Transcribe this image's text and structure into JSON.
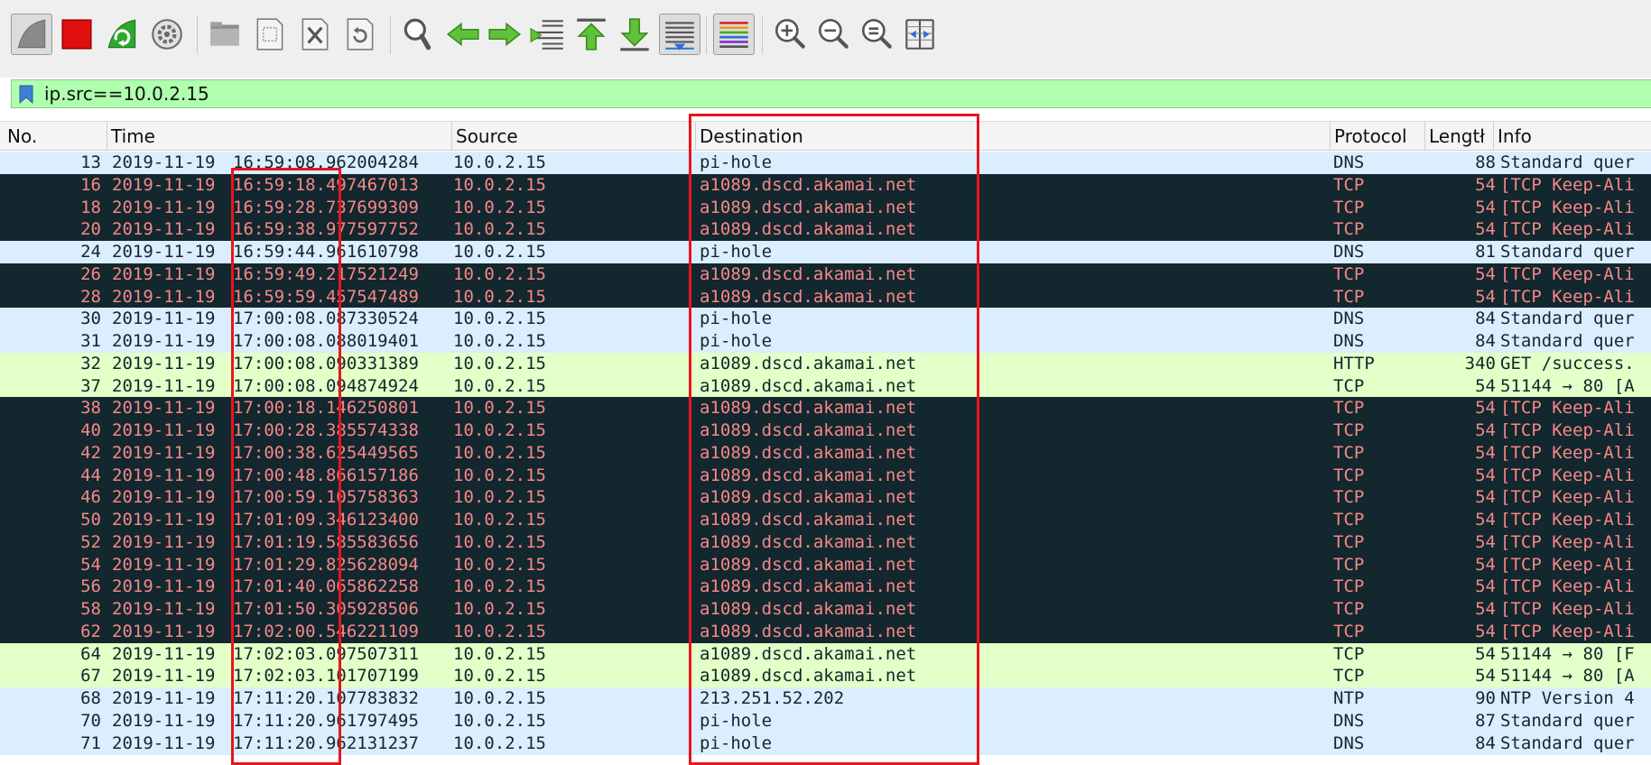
{
  "colors": {
    "toolbar_bg": "#efefef",
    "filter_bg": "#afffaf",
    "dns_row": "#daeeff",
    "tcp_keepalive_row": "#12272e",
    "tcp_keepalive_text": "#f78787",
    "http_row": "#e4ffc7",
    "highlight_box": "#e8141e"
  },
  "toolbar": {
    "items": [
      {
        "name": "start-capture-icon"
      },
      {
        "name": "stop-capture-icon"
      },
      {
        "name": "restart-capture-icon"
      },
      {
        "name": "capture-options-icon"
      },
      {
        "name": "open-file-icon"
      },
      {
        "name": "save-file-icon"
      },
      {
        "name": "close-file-icon"
      },
      {
        "name": "reload-file-icon"
      },
      {
        "name": "find-packet-icon"
      },
      {
        "name": "go-back-icon"
      },
      {
        "name": "go-forward-icon"
      },
      {
        "name": "go-to-packet-icon"
      },
      {
        "name": "go-first-packet-icon"
      },
      {
        "name": "go-last-packet-icon"
      },
      {
        "name": "autoscroll-icon"
      },
      {
        "name": "colorize-icon"
      },
      {
        "name": "zoom-in-icon"
      },
      {
        "name": "zoom-out-icon"
      },
      {
        "name": "normal-size-icon"
      },
      {
        "name": "resize-columns-icon"
      }
    ]
  },
  "filter": {
    "value": "ip.src==10.0.2.15"
  },
  "columns": {
    "no": "No.",
    "time": "Time",
    "source": "Source",
    "destination": "Destination",
    "protocol": "Protocol",
    "length": "Lengtł",
    "info": "Info"
  },
  "packets": [
    {
      "no": "13",
      "date": "2019-11-19",
      "time": "16:59:08.962004284",
      "src": "10.0.2.15",
      "dst": "pi-hole",
      "proto": "DNS",
      "len": "88",
      "info": "Standard quer",
      "kind": "dns"
    },
    {
      "no": "16",
      "date": "2019-11-19",
      "time": "16:59:18.497467013",
      "src": "10.0.2.15",
      "dst": "a1089.dscd.akamai.net",
      "proto": "TCP",
      "len": "54",
      "info": "[TCP Keep-Ali",
      "kind": "tcpka"
    },
    {
      "no": "18",
      "date": "2019-11-19",
      "time": "16:59:28.737699309",
      "src": "10.0.2.15",
      "dst": "a1089.dscd.akamai.net",
      "proto": "TCP",
      "len": "54",
      "info": "[TCP Keep-Ali",
      "kind": "tcpka"
    },
    {
      "no": "20",
      "date": "2019-11-19",
      "time": "16:59:38.977597752",
      "src": "10.0.2.15",
      "dst": "a1089.dscd.akamai.net",
      "proto": "TCP",
      "len": "54",
      "info": "[TCP Keep-Ali",
      "kind": "tcpka"
    },
    {
      "no": "24",
      "date": "2019-11-19",
      "time": "16:59:44.961610798",
      "src": "10.0.2.15",
      "dst": "pi-hole",
      "proto": "DNS",
      "len": "81",
      "info": "Standard quer",
      "kind": "dns"
    },
    {
      "no": "26",
      "date": "2019-11-19",
      "time": "16:59:49.217521249",
      "src": "10.0.2.15",
      "dst": "a1089.dscd.akamai.net",
      "proto": "TCP",
      "len": "54",
      "info": "[TCP Keep-Ali",
      "kind": "tcpka"
    },
    {
      "no": "28",
      "date": "2019-11-19",
      "time": "16:59:59.457547489",
      "src": "10.0.2.15",
      "dst": "a1089.dscd.akamai.net",
      "proto": "TCP",
      "len": "54",
      "info": "[TCP Keep-Ali",
      "kind": "tcpka"
    },
    {
      "no": "30",
      "date": "2019-11-19",
      "time": "17:00:08.087330524",
      "src": "10.0.2.15",
      "dst": "pi-hole",
      "proto": "DNS",
      "len": "84",
      "info": "Standard quer",
      "kind": "dns"
    },
    {
      "no": "31",
      "date": "2019-11-19",
      "time": "17:00:08.088019401",
      "src": "10.0.2.15",
      "dst": "pi-hole",
      "proto": "DNS",
      "len": "84",
      "info": "Standard quer",
      "kind": "dns"
    },
    {
      "no": "32",
      "date": "2019-11-19",
      "time": "17:00:08.090331389",
      "src": "10.0.2.15",
      "dst": "a1089.dscd.akamai.net",
      "proto": "HTTP",
      "len": "340",
      "info": "GET /success.",
      "kind": "http"
    },
    {
      "no": "37",
      "date": "2019-11-19",
      "time": "17:00:08.094874924",
      "src": "10.0.2.15",
      "dst": "a1089.dscd.akamai.net",
      "proto": "TCP",
      "len": "54",
      "info": "51144 → 80 [A",
      "kind": "tcp-light"
    },
    {
      "no": "38",
      "date": "2019-11-19",
      "time": "17:00:18.146250801",
      "src": "10.0.2.15",
      "dst": "a1089.dscd.akamai.net",
      "proto": "TCP",
      "len": "54",
      "info": "[TCP Keep-Ali",
      "kind": "tcpka"
    },
    {
      "no": "40",
      "date": "2019-11-19",
      "time": "17:00:28.385574338",
      "src": "10.0.2.15",
      "dst": "a1089.dscd.akamai.net",
      "proto": "TCP",
      "len": "54",
      "info": "[TCP Keep-Ali",
      "kind": "tcpka"
    },
    {
      "no": "42",
      "date": "2019-11-19",
      "time": "17:00:38.625449565",
      "src": "10.0.2.15",
      "dst": "a1089.dscd.akamai.net",
      "proto": "TCP",
      "len": "54",
      "info": "[TCP Keep-Ali",
      "kind": "tcpka"
    },
    {
      "no": "44",
      "date": "2019-11-19",
      "time": "17:00:48.866157186",
      "src": "10.0.2.15",
      "dst": "a1089.dscd.akamai.net",
      "proto": "TCP",
      "len": "54",
      "info": "[TCP Keep-Ali",
      "kind": "tcpka"
    },
    {
      "no": "46",
      "date": "2019-11-19",
      "time": "17:00:59.105758363",
      "src": "10.0.2.15",
      "dst": "a1089.dscd.akamai.net",
      "proto": "TCP",
      "len": "54",
      "info": "[TCP Keep-Ali",
      "kind": "tcpka"
    },
    {
      "no": "50",
      "date": "2019-11-19",
      "time": "17:01:09.346123400",
      "src": "10.0.2.15",
      "dst": "a1089.dscd.akamai.net",
      "proto": "TCP",
      "len": "54",
      "info": "[TCP Keep-Ali",
      "kind": "tcpka"
    },
    {
      "no": "52",
      "date": "2019-11-19",
      "time": "17:01:19.585583656",
      "src": "10.0.2.15",
      "dst": "a1089.dscd.akamai.net",
      "proto": "TCP",
      "len": "54",
      "info": "[TCP Keep-Ali",
      "kind": "tcpka"
    },
    {
      "no": "54",
      "date": "2019-11-19",
      "time": "17:01:29.825628094",
      "src": "10.0.2.15",
      "dst": "a1089.dscd.akamai.net",
      "proto": "TCP",
      "len": "54",
      "info": "[TCP Keep-Ali",
      "kind": "tcpka"
    },
    {
      "no": "56",
      "date": "2019-11-19",
      "time": "17:01:40.065862258",
      "src": "10.0.2.15",
      "dst": "a1089.dscd.akamai.net",
      "proto": "TCP",
      "len": "54",
      "info": "[TCP Keep-Ali",
      "kind": "tcpka"
    },
    {
      "no": "58",
      "date": "2019-11-19",
      "time": "17:01:50.305928506",
      "src": "10.0.2.15",
      "dst": "a1089.dscd.akamai.net",
      "proto": "TCP",
      "len": "54",
      "info": "[TCP Keep-Ali",
      "kind": "tcpka"
    },
    {
      "no": "62",
      "date": "2019-11-19",
      "time": "17:02:00.546221109",
      "src": "10.0.2.15",
      "dst": "a1089.dscd.akamai.net",
      "proto": "TCP",
      "len": "54",
      "info": "[TCP Keep-Ali",
      "kind": "tcpka"
    },
    {
      "no": "64",
      "date": "2019-11-19",
      "time": "17:02:03.097507311",
      "src": "10.0.2.15",
      "dst": "a1089.dscd.akamai.net",
      "proto": "TCP",
      "len": "54",
      "info": "51144 → 80 [F",
      "kind": "tcp-light"
    },
    {
      "no": "67",
      "date": "2019-11-19",
      "time": "17:02:03.101707199",
      "src": "10.0.2.15",
      "dst": "a1089.dscd.akamai.net",
      "proto": "TCP",
      "len": "54",
      "info": "51144 → 80 [A",
      "kind": "tcp-light"
    },
    {
      "no": "68",
      "date": "2019-11-19",
      "time": "17:11:20.107783832",
      "src": "10.0.2.15",
      "dst": "213.251.52.202",
      "proto": "NTP",
      "len": "90",
      "info": "NTP Version 4",
      "kind": "ntp"
    },
    {
      "no": "70",
      "date": "2019-11-19",
      "time": "17:11:20.961797495",
      "src": "10.0.2.15",
      "dst": "pi-hole",
      "proto": "DNS",
      "len": "87",
      "info": "Standard quer",
      "kind": "dns"
    },
    {
      "no": "71",
      "date": "2019-11-19",
      "time": "17:11:20.962131237",
      "src": "10.0.2.15",
      "dst": "pi-hole",
      "proto": "DNS",
      "len": "84",
      "info": "Standard quer",
      "kind": "dns"
    }
  ]
}
